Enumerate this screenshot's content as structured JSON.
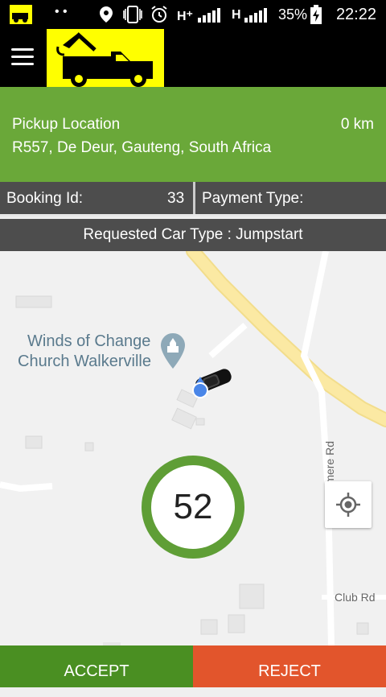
{
  "status_bar": {
    "signal_text_1": "H⁺",
    "signal_text_2": "H",
    "battery": "35%",
    "time": "22:22"
  },
  "pickup": {
    "label": "Pickup Location",
    "distance": "0 km",
    "address": "R557, De Deur, Gauteng, South Africa"
  },
  "booking": {
    "id_label": "Booking Id:",
    "id_value": "33",
    "payment_label": "Payment Type:",
    "car_type": "Requested Car Type : Jumpstart"
  },
  "map": {
    "poi_line1": "Winds of Change",
    "poi_line2": "Church Walkerville",
    "street1": "Grasmere Rd",
    "street2": "Club Rd",
    "countdown": "52"
  },
  "actions": {
    "accept": "ACCEPT",
    "reject": "REJECT"
  },
  "colors": {
    "header_green": "#6aa839",
    "accept_green": "#4a8f22",
    "reject_orange": "#e2552c",
    "logo_yellow": "#ffff00",
    "timer_ring": "#5f9e36"
  }
}
